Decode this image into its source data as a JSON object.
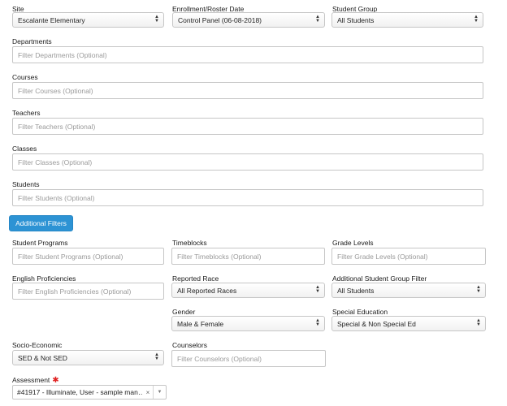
{
  "site": {
    "label": "Site",
    "value": "Escalante Elementary"
  },
  "enrollment": {
    "label": "Enrollment/Roster Date",
    "value": "Control Panel (06-08-2018)"
  },
  "student_group": {
    "label": "Student Group",
    "value": "All Students"
  },
  "departments": {
    "label": "Departments",
    "placeholder": "Filter Departments (Optional)"
  },
  "courses": {
    "label": "Courses",
    "placeholder": "Filter Courses (Optional)"
  },
  "teachers": {
    "label": "Teachers",
    "placeholder": "Filter Teachers (Optional)"
  },
  "classes": {
    "label": "Classes",
    "placeholder": "Filter Classes (Optional)"
  },
  "students": {
    "label": "Students",
    "placeholder": "Filter Students (Optional)"
  },
  "additional_filters_button": "Additional Filters",
  "student_programs": {
    "label": "Student Programs",
    "placeholder": "Filter Student Programs (Optional)"
  },
  "timeblocks": {
    "label": "Timeblocks",
    "placeholder": "Filter Timeblocks (Optional)"
  },
  "grade_levels": {
    "label": "Grade Levels",
    "placeholder": "Filter Grade Levels (Optional)"
  },
  "english_proficiencies": {
    "label": "English Proficiencies",
    "placeholder": "Filter English Proficiencies (Optional)"
  },
  "reported_race": {
    "label": "Reported Race",
    "value": "All Reported Races"
  },
  "additional_student_group": {
    "label": "Additional Student Group Filter",
    "value": "All Students"
  },
  "gender": {
    "label": "Gender",
    "value": "Male & Female"
  },
  "special_education": {
    "label": "Special Education",
    "value": "Special & Non Special Ed"
  },
  "socio_economic": {
    "label": "Socio-Economic",
    "value": "SED & Not SED"
  },
  "counselors": {
    "label": "Counselors",
    "placeholder": "Filter Counselors (Optional)"
  },
  "assessment": {
    "label": "Assessment",
    "required_mark": "✱",
    "value": "#41917 - Illuminate, User - sample man…",
    "clear_glyph": "×",
    "dropdown_glyph": "▼"
  },
  "colors": {
    "button_bg": "#2d93d4",
    "required": "#e02020",
    "border": "#c6c6c6"
  },
  "icons": {
    "select_arrows": "select-arrows-icon",
    "clear": "clear-icon",
    "dropdown": "dropdown-arrow-icon"
  }
}
